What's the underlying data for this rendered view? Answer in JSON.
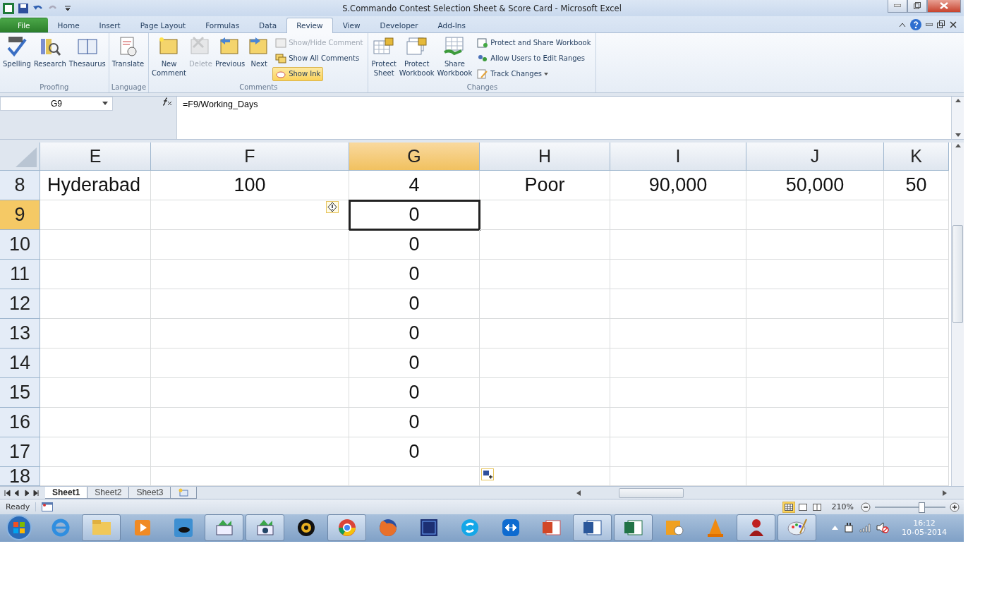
{
  "window": {
    "title": "S.Commando Contest Selection Sheet & Score Card  -  Microsoft Excel"
  },
  "ribbon_tabs": [
    {
      "label": "File",
      "selected": false
    },
    {
      "label": "Home",
      "selected": false
    },
    {
      "label": "Insert",
      "selected": false
    },
    {
      "label": "Page Layout",
      "selected": false
    },
    {
      "label": "Formulas",
      "selected": false
    },
    {
      "label": "Data",
      "selected": false
    },
    {
      "label": "Review",
      "selected": true
    },
    {
      "label": "View",
      "selected": false
    },
    {
      "label": "Developer",
      "selected": false
    },
    {
      "label": "Add-Ins",
      "selected": false
    }
  ],
  "ribbon_groups": [
    {
      "label": "Proofing",
      "large": [
        {
          "label": "Spelling",
          "disabled": false
        },
        {
          "label": "Research",
          "disabled": false
        },
        {
          "label": "Thesaurus",
          "disabled": false
        }
      ]
    },
    {
      "label": "Language",
      "large": [
        {
          "label": "Translate",
          "disabled": false
        }
      ]
    },
    {
      "label": "Comments",
      "large": [
        {
          "label": "New Comment",
          "disabled": false
        },
        {
          "label": "Delete",
          "disabled": true
        },
        {
          "label": "Previous",
          "disabled": false
        },
        {
          "label": "Next",
          "disabled": false
        }
      ],
      "small": [
        {
          "label": "Show/Hide Comment",
          "disabled": true,
          "selected": false,
          "dropdown": false
        },
        {
          "label": "Show All Comments",
          "disabled": false,
          "selected": false,
          "dropdown": false
        },
        {
          "label": "Show Ink",
          "disabled": false,
          "selected": true,
          "dropdown": false
        }
      ]
    },
    {
      "label": "Changes",
      "large": [
        {
          "label": "Protect Sheet",
          "disabled": false
        },
        {
          "label": "Protect Workbook",
          "disabled": false
        },
        {
          "label": "Share Workbook",
          "disabled": false
        }
      ],
      "small": [
        {
          "label": "Protect and Share Workbook",
          "disabled": false,
          "selected": false,
          "dropdown": false
        },
        {
          "label": "Allow Users to Edit Ranges",
          "disabled": false,
          "selected": false,
          "dropdown": false
        },
        {
          "label": "Track Changes",
          "disabled": false,
          "selected": false,
          "dropdown": true
        }
      ]
    }
  ],
  "formula_bar": {
    "name_box": "G9",
    "formula": "=F9/Working_Days"
  },
  "columns": [
    {
      "label": "E",
      "selected": false
    },
    {
      "label": "F",
      "selected": false
    },
    {
      "label": "G",
      "selected": true
    },
    {
      "label": "H",
      "selected": false
    },
    {
      "label": "I",
      "selected": false
    },
    {
      "label": "J",
      "selected": false
    },
    {
      "label": "K",
      "selected": false
    }
  ],
  "rows": [
    {
      "label": "8",
      "selected": false,
      "cells": [
        "Hyderabad",
        "100",
        "4",
        "Poor",
        "90,000",
        "50,000",
        "50"
      ]
    },
    {
      "label": "9",
      "selected": true,
      "cells": [
        null,
        null,
        "0",
        null,
        null,
        null,
        null
      ]
    },
    {
      "label": "10",
      "selected": false,
      "cells": [
        null,
        null,
        "0",
        null,
        null,
        null,
        null
      ]
    },
    {
      "label": "11",
      "selected": false,
      "cells": [
        null,
        null,
        "0",
        null,
        null,
        null,
        null
      ]
    },
    {
      "label": "12",
      "selected": false,
      "cells": [
        null,
        null,
        "0",
        null,
        null,
        null,
        null
      ]
    },
    {
      "label": "13",
      "selected": false,
      "cells": [
        null,
        null,
        "0",
        null,
        null,
        null,
        null
      ]
    },
    {
      "label": "14",
      "selected": false,
      "cells": [
        null,
        null,
        "0",
        null,
        null,
        null,
        null
      ]
    },
    {
      "label": "15",
      "selected": false,
      "cells": [
        null,
        null,
        "0",
        null,
        null,
        null,
        null
      ]
    },
    {
      "label": "16",
      "selected": false,
      "cells": [
        null,
        null,
        "0",
        null,
        null,
        null,
        null
      ]
    },
    {
      "label": "17",
      "selected": false,
      "cells": [
        null,
        null,
        "0",
        null,
        null,
        null,
        null
      ]
    },
    {
      "label": "18",
      "selected": false,
      "cells": [
        null,
        null,
        null,
        null,
        null,
        null,
        null
      ]
    }
  ],
  "sheet_tabs": [
    {
      "label": "Sheet1",
      "selected": true
    },
    {
      "label": "Sheet2",
      "selected": false
    },
    {
      "label": "Sheet3",
      "selected": false
    }
  ],
  "status_bar": {
    "status": "Ready",
    "zoom": "210%",
    "zoom_slider": {
      "level": 0.66
    },
    "views": [
      {
        "selected": true
      },
      {
        "selected": false
      },
      {
        "selected": false
      }
    ]
  },
  "taskbar": {
    "apps": [
      {
        "running": false
      },
      {
        "running": true
      },
      {
        "running": false
      },
      {
        "running": false
      },
      {
        "running": true
      },
      {
        "running": true
      },
      {
        "running": false
      },
      {
        "running": true
      },
      {
        "running": false
      },
      {
        "running": false
      },
      {
        "running": false
      },
      {
        "running": false
      },
      {
        "running": false
      },
      {
        "running": true
      },
      {
        "running": true
      },
      {
        "running": false
      },
      {
        "running": false
      },
      {
        "running": true
      },
      {
        "running": true
      }
    ],
    "time": "16:12",
    "date": "10-05-2014"
  }
}
